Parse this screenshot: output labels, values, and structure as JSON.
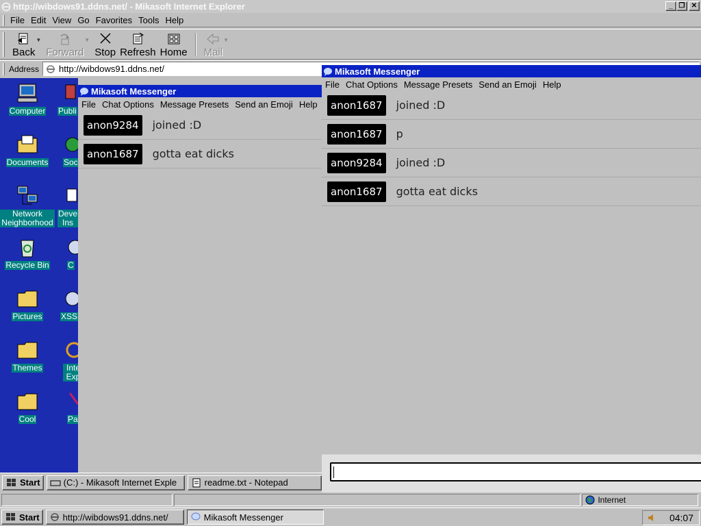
{
  "browser": {
    "title": "http://wibdows91.ddns.net/ - Mikasoft Internet Explorer",
    "menu": [
      "File",
      "Edit",
      "View",
      "Go",
      "Favorites",
      "Tools",
      "Help"
    ],
    "toolbar": {
      "back": "Back",
      "forward": "Forward",
      "stop": "Stop",
      "refresh": "Refresh",
      "home": "Home",
      "mail": "Mail"
    },
    "address_label": "Address",
    "address_value": "http://wibdows91.ddns.net/",
    "status_zone": "Internet"
  },
  "desktop": {
    "icons": [
      {
        "label": "Computer",
        "icon": "computer-icon"
      },
      {
        "label": "Documents",
        "icon": "folder-documents-icon"
      },
      {
        "label": "Network Neighborhood",
        "icon": "network-icon"
      },
      {
        "label": "Recycle Bin",
        "icon": "recycle-bin-icon"
      },
      {
        "label": "Pictures",
        "icon": "folder-icon"
      },
      {
        "label": "Themes",
        "icon": "folder-icon"
      },
      {
        "label": "Cool",
        "icon": "folder-icon"
      }
    ],
    "partial_icons": [
      "Publi",
      "Soc",
      "Deve Ins",
      "C",
      "XSS",
      "Inte Exp",
      "Pa"
    ]
  },
  "inner_taskbar": {
    "start": "Start",
    "tasks": [
      "(C:) - Mikasoft Internet Exple",
      "readme.txt - Notepad"
    ]
  },
  "messenger_left": {
    "title": "Mikasoft Messenger",
    "menu": [
      "File",
      "Chat Options",
      "Message Presets",
      "Send an Emoji",
      "Help"
    ],
    "messages": [
      {
        "user": "anon9284",
        "text": "joined :D"
      },
      {
        "user": "anon1687",
        "text": "gotta eat dicks"
      }
    ]
  },
  "messenger_right": {
    "title": "Mikasoft Messenger",
    "menu": [
      "File",
      "Chat Options",
      "Message Presets",
      "Send an Emoji",
      "Help"
    ],
    "messages": [
      {
        "user": "anon1687",
        "text": "joined :D"
      },
      {
        "user": "anon1687",
        "text": "p"
      },
      {
        "user": "anon9284",
        "text": "joined :D"
      },
      {
        "user": "anon1687",
        "text": "gotta eat dicks"
      }
    ],
    "input_value": ""
  },
  "taskbar": {
    "start": "Start",
    "tasks": [
      "http://wibdows91.ddns.net/",
      "Mikasoft Messenger"
    ],
    "clock": "04:07"
  },
  "colors": {
    "desktop_bg": "#1c2cb0",
    "title_active": "#0a22c4",
    "face": "#c0c0c0"
  }
}
